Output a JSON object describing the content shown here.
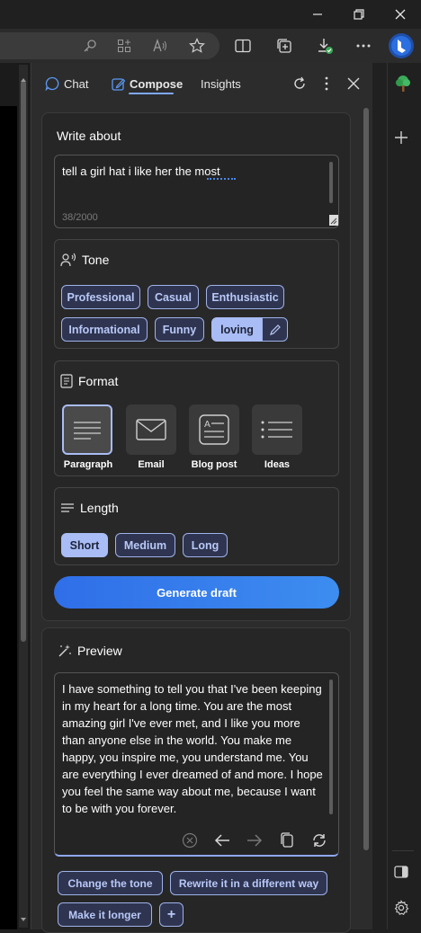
{
  "colors": {
    "accent": "#a9bcf5",
    "button_gradient_start": "#2f6ee8",
    "button_gradient_end": "#3d8df0",
    "panel_bg": "#2c2c2c"
  },
  "browser": {
    "toolbar_icons": [
      "key-icon",
      "apps-icon",
      "read-aloud-icon",
      "favorite-star-icon",
      "split-screen-icon",
      "collections-icon",
      "downloads-icon",
      "more-icon",
      "bing-icon"
    ]
  },
  "sidebar": {
    "tabs": [
      {
        "label": "Chat",
        "icon": "chat-icon"
      },
      {
        "label": "Compose",
        "icon": "compose-pen-icon",
        "selected": true
      },
      {
        "label": "Insights"
      }
    ],
    "rail_icons": [
      "tree-icon",
      "plus-icon",
      "sidebar-toggle-icon",
      "settings-gear-icon"
    ]
  },
  "compose": {
    "write_about": {
      "title": "Write about",
      "value": "tell a girl hat i like her the most",
      "counter": "38/2000"
    },
    "tone": {
      "title": "Tone",
      "options": [
        "Professional",
        "Casual",
        "Enthusiastic",
        "Informational",
        "Funny",
        "loving"
      ],
      "selected": "loving"
    },
    "format": {
      "title": "Format",
      "options": [
        "Paragraph",
        "Email",
        "Blog post",
        "Ideas"
      ],
      "selected": "Paragraph"
    },
    "length": {
      "title": "Length",
      "options": [
        "Short",
        "Medium",
        "Long"
      ],
      "selected": "Short"
    },
    "generate_label": "Generate draft"
  },
  "preview": {
    "title": "Preview",
    "text": "I have something to tell you that I've been keeping in my heart for a long time. You are the most amazing girl I've ever met, and I like you more than anyone else in the world. You make me happy, you inspire me, you understand me. You are everything I ever dreamed of and more. I hope you feel the same way about me, because I want to be with you forever.",
    "actions": [
      "Change the tone",
      "Rewrite it in a different way",
      "Make it longer",
      "+"
    ]
  }
}
